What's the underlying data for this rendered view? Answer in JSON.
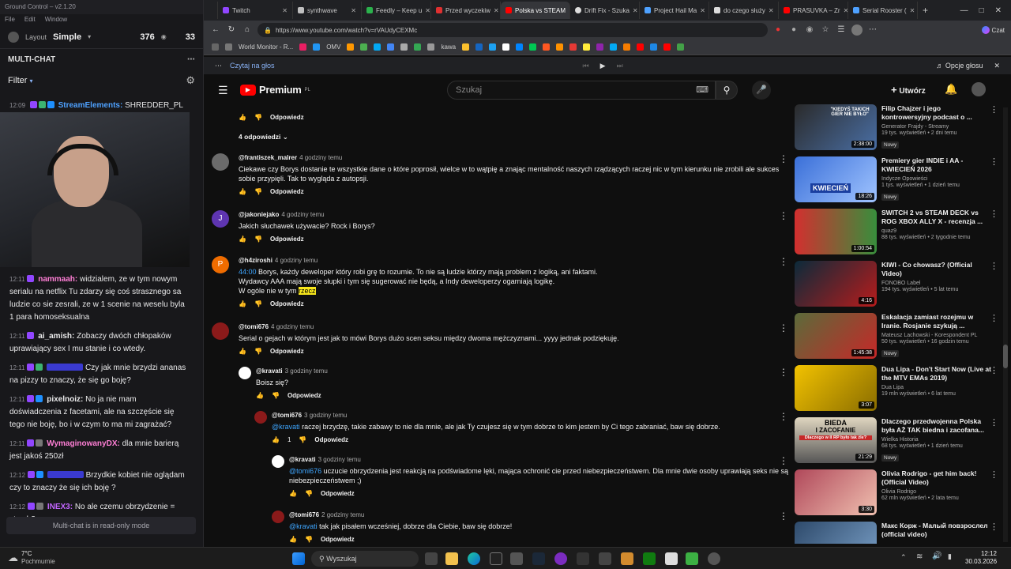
{
  "stream_app": {
    "title": "Ground Control – v2.1.20",
    "menu": [
      "File",
      "Edit",
      "Window"
    ],
    "layout_label": "Layout",
    "layout_value": "Simple",
    "viewers": "376",
    "other_count": "33",
    "multichat_title": "MULTI-CHAT",
    "filter_label": "Filter",
    "top_message": {
      "time": "12:09",
      "user": "StreamElements:",
      "text": "SHREDDER_PL"
    },
    "messages": [
      {
        "time": "12:11",
        "user": "nammaah:",
        "text": "widzialem, ze w tym nowym serialu na netflix Tu zdarzy się coś strasznego sa ludzie co sie zesrali, ze w 1 scenie na weselu byla 1 para homoseksualna",
        "color": "#ff7fd6"
      },
      {
        "time": "12:11",
        "user": "ai_amish:",
        "text": "Zobaczy dwóch chłopaków uprawiający sex I mu stanie i co wtedy.",
        "color": "#ffffff"
      },
      {
        "time": "12:11",
        "user": "",
        "text": "Czy jak mnie brzydzi ananas na pizzy to znaczy, że się go boję?",
        "color": "#4b4bff"
      },
      {
        "time": "12:11",
        "user": "pixelnoiz:",
        "text": "No ja nie mam doświadczenia z facetami, ale na szczęście się tego nie boję, bo i w czym to ma mi zagrażać?",
        "color": "#ffffff"
      },
      {
        "time": "12:11",
        "user": "WymaginowanyDX:",
        "text": "dla mnie barierą jest jakoś 250zł",
        "color": "#ff7fd6"
      },
      {
        "time": "12:12",
        "user": "",
        "text": "Brzydkie kobiet nie oglądam czy to znaczy że się ich boję ?",
        "color": "#4b4bff"
      },
      {
        "time": "12:12",
        "user": "INEX3:",
        "text": "No ale czemu obrzydzenie = strach?",
        "color": "#c266ff"
      }
    ],
    "readonly_text": "Multi-chat is in read-only mode"
  },
  "browser": {
    "tabs": [
      {
        "label": "Twitch",
        "color": "#9146ff"
      },
      {
        "label": "synthwave",
        "color": "#c0c0c0"
      },
      {
        "label": "Feedly – Keep u",
        "color": "#2bb24c"
      },
      {
        "label": "Przed wyczekiw",
        "color": "#e03030"
      },
      {
        "label": "Polska vs STEAM",
        "color": "#ff0000"
      },
      {
        "label": "Drift Fix - Szuka",
        "color": "#dddddd"
      },
      {
        "label": "Project Hail Ma",
        "color": "#4ea1ff"
      },
      {
        "label": "do czego służy",
        "color": "#dddddd"
      },
      {
        "label": "PRASUVKA – Zr",
        "color": "#ff0000"
      },
      {
        "label": "Serial Rooster (",
        "color": "#4ea1ff"
      }
    ],
    "url": "https://www.youtube.com/watch?v=rVAUdyCEXMc",
    "bookmark_label": "World Monitor - R...",
    "bookmark2": "OMV",
    "bookmark3": "kawa",
    "reader_label": "Czytaj na głos",
    "voice_options": "Opcje głosu",
    "edge_label": "Czat"
  },
  "youtube": {
    "logo": "Premium",
    "logo_region": "PL",
    "search_placeholder": "Szukaj",
    "create_label": "Utwórz",
    "reply_label": "Odpowiedz",
    "replies_toggle": "4 odpowiedzi",
    "comments": [
      {
        "user": "@frantiszek_malrer",
        "time": "4 godziny temu",
        "text": "Ciekawe czy Borys dostanie te wszystkie dane o które poprosił,  wielce w to wątpię  a znając mentalność naszych rządzących raczej nic w tym kierunku nie zrobili ale sukces sobie przypięli. Tak to wygląda z autopsji.",
        "avatar": "#6b6b6b",
        "initial": ""
      },
      {
        "user": "@jakoniejako",
        "time": "4 godziny temu",
        "text": "Jakich słuchawek używacie? Rock i Borys?",
        "avatar": "#5e35b1",
        "initial": "J"
      },
      {
        "user": "@h4ziroshi",
        "time": "4 godziny temu",
        "ts": "44:00",
        "text": " Borys, każdy deweloper który robi grę to rozumie. To nie są ludzie którzy mają problem z logiką, ani faktami. Wydawcy AAA mają swoje słupki i tym się sugerować nie będą, a Indy deweloperzy ogarniają logikę.",
        "text2": "W ogóle nie w tym ",
        "hl": "rzecz",
        "avatar": "#ef6c00",
        "initial": "P"
      },
      {
        "user": "@tomi676",
        "time": "4 godziny temu",
        "text": "Serial o gejach w którym jest jak to mówi Borys dużo scen seksu między dwoma mężczyznami... yyyy jednak podziękuję.",
        "avatar": "#8b1a1a",
        "initial": ""
      }
    ],
    "replies": [
      {
        "user": "@kravati",
        "time": "3 godziny temu",
        "text": "Boisz się?"
      },
      {
        "user": "@tomi676",
        "time": "3 godziny temu",
        "mention": "@kravati",
        "text": " raczej brzydzę, takie zabawy to nie dla mnie, ale jak Ty czujesz się w tym dobrze to kim jestem by Ci tego zabraniać, baw się dobrze.",
        "likes": "1"
      },
      {
        "user": "@kravati",
        "time": "3 godziny temu",
        "mention": "@tomi676",
        "text": "  uczucie obrzydzenia jest reakcją na podświadome lęki, mająca ochronić cie przed niebezpieczeństwem. Dla mnie dwie osoby uprawiają seks nie są niebezpieczeństwem ;)"
      },
      {
        "user": "@tomi676",
        "time": "2 godziny temu",
        "mention": "@kravati",
        "text": " tak jak pisałem wcześniej, dobrze dla Ciebie, baw się dobrze!"
      }
    ],
    "videos": [
      {
        "title": "Filip Chajzer i jego kontrowersyjny podcast o ...",
        "channel": "Generator Frajdy - Streamy",
        "meta": "19 tys. wyświetleń • 2 dni temu",
        "dur": "2:38:00",
        "badge": "Nowy",
        "c1": "#2a2a2a",
        "c2": "#4a6fa5"
      },
      {
        "title": "Premiery gier INDIE i AA - KWIECIEŃ 2026",
        "channel": "Indycze Opowieści",
        "meta": "1 tys. wyświetleń • 1 dzień temu",
        "dur": "18:26",
        "badge": "Nowy",
        "c1": "#3a6fd8",
        "c2": "#a0c4ff"
      },
      {
        "title": "SWITCH 2 vs STEAM DECK vs ROG XBOX ALLY X - recenzja ...",
        "channel": "quaz9",
        "meta": "88 tys. wyświetleń • 2 tygodnie temu",
        "dur": "1:00:54",
        "badge": "",
        "c1": "#d32f2f",
        "c2": "#388e3c"
      },
      {
        "title": "KIWI - Co chowasz? (Official Video)",
        "channel": "FONOBO Label",
        "meta": "194 tys. wyświetleń • 5 lat temu",
        "dur": "4:16",
        "badge": "",
        "c1": "#0b2a3a",
        "c2": "#b71c1c"
      },
      {
        "title": "Eskalacja zamiast rozejmu w Iranie. Rosjanie szykują ...",
        "channel": "Mateusz Lachowski - Korespondent PL",
        "meta": "50 tys. wyświetleń • 16 godzin temu",
        "dur": "1:45:38",
        "badge": "Nowy",
        "c1": "#5b6b3a",
        "c2": "#c62828"
      },
      {
        "title": "Dua Lipa - Don't Start Now (Live at the MTV EMAs 2019)",
        "channel": "Dua Lipa",
        "meta": "19 mln wyświetleń • 6 lat temu",
        "dur": "3:07",
        "badge": "",
        "c1": "#f2c200",
        "c2": "#8a6d00"
      },
      {
        "title": "Dlaczego przedwojenna Polska była AŻ TAK biedna i zacofana...",
        "channel": "Wielka Historia",
        "meta": "68 tys. wyświetleń • 1 dzień temu",
        "dur": "21:29",
        "badge": "Nowy",
        "c1": "#e0d6c0",
        "c2": "#555"
      },
      {
        "title": "Olivia Rodrigo - get him back! (Official Video)",
        "channel": "Olivia Rodrigo",
        "meta": "62 mln wyświetleń • 2 lata temu",
        "dur": "3:30",
        "badge": "",
        "c1": "#b0485a",
        "c2": "#f0c0b0"
      },
      {
        "title": "Макс Корж - Малый повзрослел (official video)",
        "channel": "",
        "meta": "",
        "dur": "",
        "badge": "",
        "c1": "#2e4a6b",
        "c2": "#7aa0c8"
      }
    ],
    "thumb_texts": {
      "t1": "\"KIEDYŚ TAKICH GIER NIE BYŁO\"",
      "t2": "KWIECIEŃ",
      "t7a": "BIEDA",
      "t7b": "I ZACOFANIE",
      "t7c": "Dlaczego w II RP było tak źle?"
    }
  },
  "taskbar": {
    "weather_temp": "7°C",
    "weather_desc": "Pochmurnie",
    "search": "Wyszukaj",
    "time": "12:12",
    "date": "30.03.2026"
  }
}
